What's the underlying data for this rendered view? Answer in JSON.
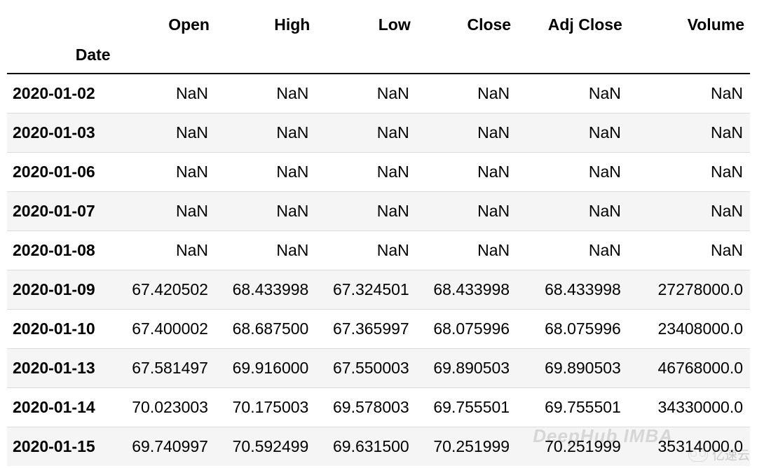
{
  "table": {
    "index_name": "Date",
    "columns": [
      "Open",
      "High",
      "Low",
      "Close",
      "Adj Close",
      "Volume"
    ],
    "rows": [
      {
        "date": "2020-01-02",
        "cells": [
          "NaN",
          "NaN",
          "NaN",
          "NaN",
          "NaN",
          "NaN"
        ]
      },
      {
        "date": "2020-01-03",
        "cells": [
          "NaN",
          "NaN",
          "NaN",
          "NaN",
          "NaN",
          "NaN"
        ]
      },
      {
        "date": "2020-01-06",
        "cells": [
          "NaN",
          "NaN",
          "NaN",
          "NaN",
          "NaN",
          "NaN"
        ]
      },
      {
        "date": "2020-01-07",
        "cells": [
          "NaN",
          "NaN",
          "NaN",
          "NaN",
          "NaN",
          "NaN"
        ]
      },
      {
        "date": "2020-01-08",
        "cells": [
          "NaN",
          "NaN",
          "NaN",
          "NaN",
          "NaN",
          "NaN"
        ]
      },
      {
        "date": "2020-01-09",
        "cells": [
          "67.420502",
          "68.433998",
          "67.324501",
          "68.433998",
          "68.433998",
          "27278000.0"
        ]
      },
      {
        "date": "2020-01-10",
        "cells": [
          "67.400002",
          "68.687500",
          "67.365997",
          "68.075996",
          "68.075996",
          "23408000.0"
        ]
      },
      {
        "date": "2020-01-13",
        "cells": [
          "67.581497",
          "69.916000",
          "67.550003",
          "69.890503",
          "69.890503",
          "46768000.0"
        ]
      },
      {
        "date": "2020-01-14",
        "cells": [
          "70.023003",
          "70.175003",
          "69.578003",
          "69.755501",
          "69.755501",
          "34330000.0"
        ]
      },
      {
        "date": "2020-01-15",
        "cells": [
          "69.740997",
          "70.592499",
          "69.631500",
          "70.251999",
          "70.251999",
          "35314000.0"
        ]
      }
    ]
  },
  "watermarks": {
    "primary": "DeepHub IMBA",
    "secondary": "亿速云"
  }
}
